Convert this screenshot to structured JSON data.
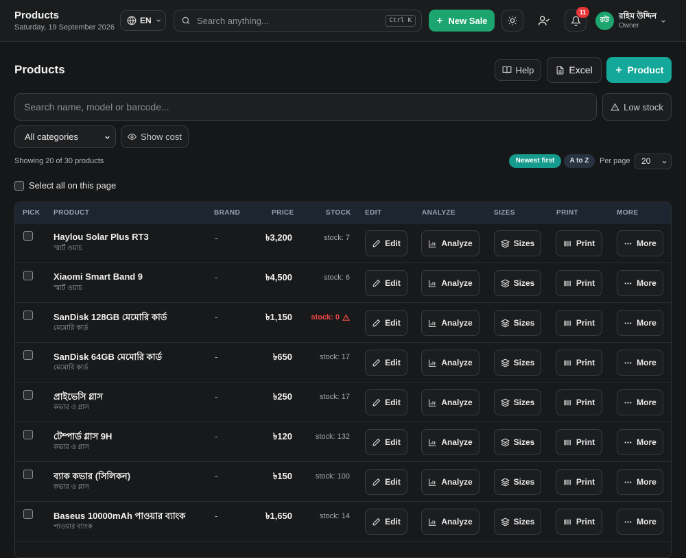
{
  "header": {
    "title": "Products",
    "date": "Saturday, 19 September 2026",
    "language": "EN",
    "search_placeholder": "Search anything...",
    "search_shortcut": "Ctrl K",
    "new_sale_label": "New Sale",
    "notification_count": "11",
    "user": {
      "initials": "রউ",
      "name": "রহিম উদ্দিন",
      "role": "Owner"
    }
  },
  "page": {
    "title": "Products",
    "help_label": "Help",
    "excel_label": "Excel",
    "add_product_label": "Product",
    "search_placeholder": "Search name, model or barcode...",
    "low_stock_label": "Low stock",
    "category_selected": "All categories",
    "show_cost_label": "Show cost",
    "showing_text": "Showing 20 of 30 products",
    "sort_newest": "Newest first",
    "sort_az": "A to Z",
    "per_page_label": "Per page",
    "per_page_value": "20",
    "select_all_label": "Select all on this page"
  },
  "table": {
    "columns": [
      "PICK",
      "PRODUCT",
      "BRAND",
      "PRICE",
      "STOCK",
      "EDIT",
      "ANALYZE",
      "SIZES",
      "PRINT",
      "MORE"
    ],
    "action_labels": {
      "edit": "Edit",
      "analyze": "Analyze",
      "sizes": "Sizes",
      "print": "Print",
      "more": "More"
    },
    "rows": [
      {
        "name": "Haylou Solar Plus RT3",
        "category": "স্মার্ট ওয়াচ",
        "brand": "-",
        "price": "৳3,200",
        "stock": "stock: 7"
      },
      {
        "name": "Xiaomi Smart Band 9",
        "category": "স্মার্ট ওয়াচ",
        "brand": "-",
        "price": "৳4,500",
        "stock": "stock: 6"
      },
      {
        "name": "SanDisk 128GB মেমোরি কার্ড",
        "category": "মেমোরি কার্ড",
        "brand": "-",
        "price": "৳1,150",
        "stock": "stock: 0"
      },
      {
        "name": "SanDisk 64GB মেমোরি কার্ড",
        "category": "মেমোরি কার্ড",
        "brand": "-",
        "price": "৳650",
        "stock": "stock: 17"
      },
      {
        "name": "প্রাইভেসি গ্লাস",
        "category": "কভার ও গ্লাস",
        "brand": "-",
        "price": "৳250",
        "stock": "stock: 17"
      },
      {
        "name": "টেম্পার্ড গ্লাস 9H",
        "category": "কভার ও গ্লাস",
        "brand": "-",
        "price": "৳120",
        "stock": "stock: 132"
      },
      {
        "name": "ব্যাক কভার (সিলিকন)",
        "category": "কভার ও গ্লাস",
        "brand": "-",
        "price": "৳150",
        "stock": "stock: 100"
      },
      {
        "name": "Baseus 10000mAh পাওয়ার ব্যাংক",
        "category": "পাওয়ার ব্যাংক",
        "brand": "-",
        "price": "৳1,650",
        "stock": "stock: 14"
      }
    ]
  },
  "colors": {
    "accent_green": "#1da56f",
    "accent_teal": "#14a89a",
    "danger": "#f04848",
    "background": "#161718"
  }
}
